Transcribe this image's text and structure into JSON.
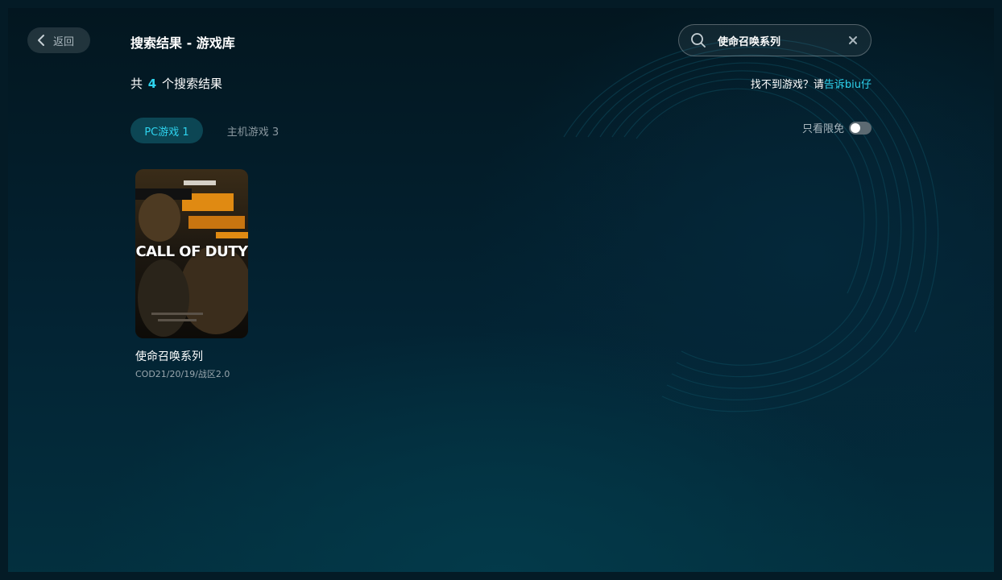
{
  "header": {
    "back_label": "返回",
    "title": "搜索结果 - 游戏库"
  },
  "search": {
    "value": "使命召唤系列",
    "placeholder": ""
  },
  "results": {
    "prefix": "共",
    "count": "4",
    "suffix": "个搜索结果"
  },
  "feedback": {
    "text": "找不到游戏？请",
    "link": "告诉biu仔"
  },
  "tabs": [
    {
      "label": "PC游戏 1",
      "active": true
    },
    {
      "label": "主机游戏 3",
      "active": false
    }
  ],
  "filter": {
    "label": "只看限免",
    "enabled": false
  },
  "games": [
    {
      "name": "使命召唤系列",
      "subtitle": "COD21/20/19/战区2.0",
      "cover_logo": "CALL OF DUTY"
    }
  ],
  "colors": {
    "accent": "#2ed3ee",
    "tab_active_bg": "#0c4654",
    "text": "#ffffff",
    "muted": "#9aa7ae"
  },
  "icons": {
    "back": "chevron-left-icon",
    "search": "search-icon",
    "clear": "close-icon"
  }
}
